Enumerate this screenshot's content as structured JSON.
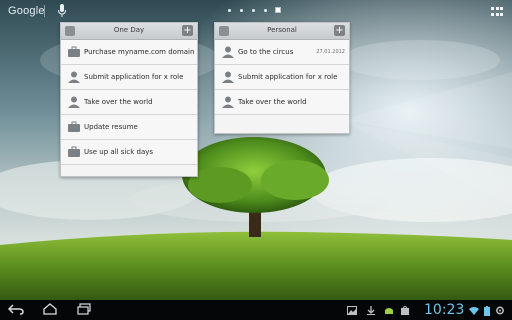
{
  "search": {
    "label": "Google"
  },
  "home_indicator": {
    "pages": 5,
    "current": 3
  },
  "widgets": [
    {
      "title": "One Day",
      "items": [
        {
          "icon": "briefcase-icon",
          "label": "Purchase myname.com domain"
        },
        {
          "icon": "person-icon",
          "label": "Submit application for x role"
        },
        {
          "icon": "person-icon",
          "label": "Take over the world"
        },
        {
          "icon": "briefcase-icon",
          "label": "Update resume"
        },
        {
          "icon": "briefcase-icon",
          "label": "Use up all sick days"
        }
      ]
    },
    {
      "title": "Personal",
      "items": [
        {
          "icon": "person-icon",
          "label": "Go to the circus",
          "date": "27.01.2012"
        },
        {
          "icon": "person-icon",
          "label": "Submit application for x role"
        },
        {
          "icon": "person-icon",
          "label": "Take over the world"
        }
      ]
    }
  ],
  "status": {
    "time": "10:23"
  },
  "colors": {
    "clock": "#6ec6ea",
    "navbar": "#050607"
  }
}
